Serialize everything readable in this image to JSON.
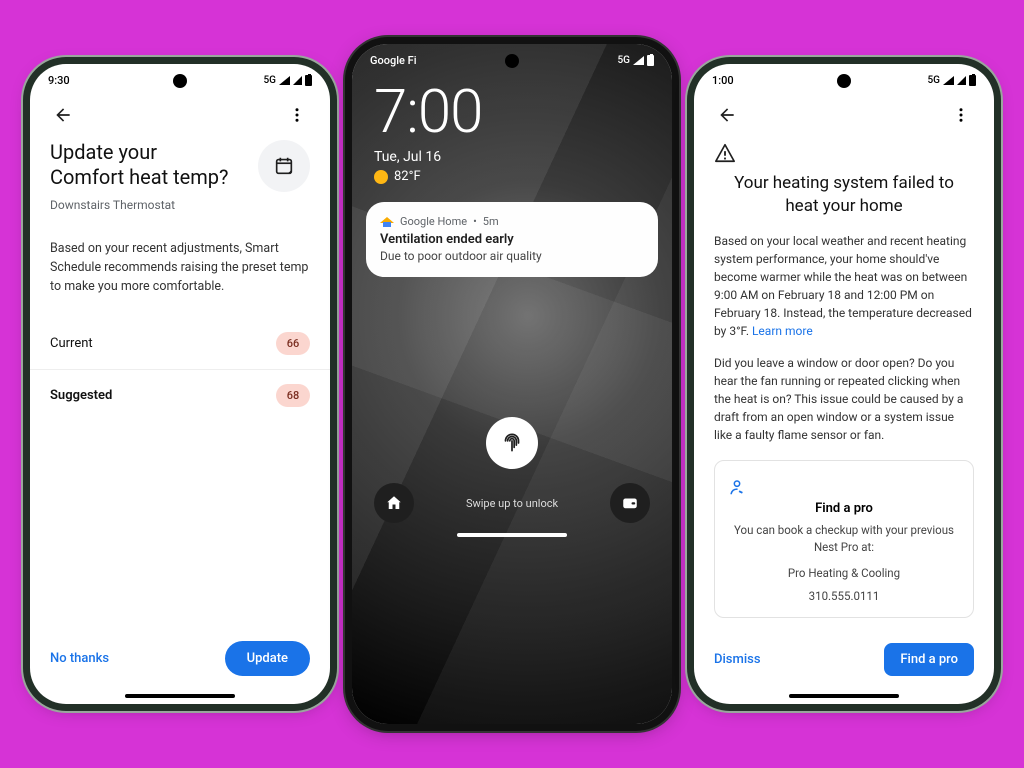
{
  "phone1": {
    "status": {
      "time": "9:30",
      "net": "5G"
    },
    "title": "Update your\nComfort heat temp?",
    "subtitle": "Downstairs Thermostat",
    "body": "Based on your recent adjustments, Smart Schedule recommends raising the preset temp to make you more comfortable.",
    "rows": {
      "current_label": "Current",
      "current_value": "66",
      "suggested_label": "Suggested",
      "suggested_value": "68"
    },
    "actions": {
      "secondary": "No thanks",
      "primary": "Update"
    }
  },
  "phone2": {
    "status": {
      "carrier": "Google Fi",
      "net": "5G"
    },
    "clock": "7:00",
    "date": "Tue, Jul 16",
    "weather_temp": "82°F",
    "notification": {
      "app": "Google Home",
      "age": "5m",
      "title": "Ventilation ended early",
      "body": "Due to poor outdoor air quality"
    },
    "swipe": "Swipe up to unlock"
  },
  "phone3": {
    "status": {
      "time": "1:00",
      "net": "5G"
    },
    "title": "Your heating system failed to heat your home",
    "para1_a": "Based on your local weather and recent heating system performance, your home should've become warmer while the heat was on between 9:00 AM on February 18 and 12:00 PM on February 18. Instead, the temperature decreased by 3°F. ",
    "para1_link": "Learn more",
    "para2": "Did you leave a window or door open? Do you hear the fan running or repeated clicking when the heat is on? This issue could be caused by a draft from an open window or a system issue like a faulty flame sensor or fan.",
    "card": {
      "heading": "Find a pro",
      "body": "You can book a checkup with your previous Nest Pro at:",
      "name": "Pro Heating & Cooling",
      "phone": "310.555.0111"
    },
    "actions": {
      "secondary": "Dismiss",
      "primary": "Find a pro"
    }
  }
}
